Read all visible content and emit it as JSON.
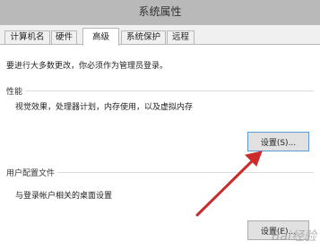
{
  "window": {
    "title": "系统属性"
  },
  "tabs": [
    {
      "label": "计算机名"
    },
    {
      "label": "硬件"
    },
    {
      "label": "高级",
      "active": true
    },
    {
      "label": "系统保护"
    },
    {
      "label": "远程"
    }
  ],
  "main": {
    "admin_note": "要进行大多数更改，你必须作为管理员登录。",
    "performance": {
      "label": "性能",
      "description": "视觉效果，处理器计划，内存使用，以及虚拟内存",
      "button_label": "设置(S)..."
    },
    "user_profiles": {
      "label": "用户配置文件",
      "description": "与登录帐户相关的桌面设置",
      "button_label": "设置(E)..."
    }
  },
  "annotation": {
    "arrow_color": "#cc2b2b"
  },
  "watermark": {
    "text": "Bai经验"
  }
}
